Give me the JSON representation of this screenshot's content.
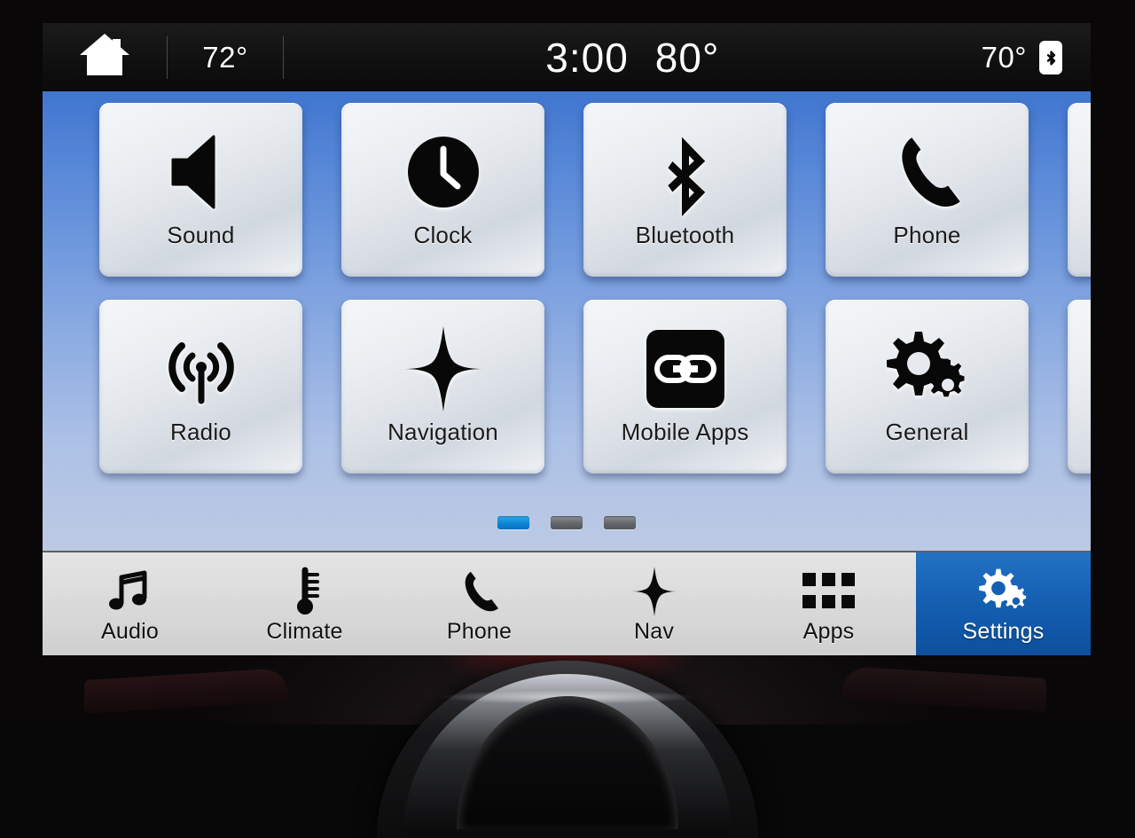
{
  "status_bar": {
    "home_icon": "home-icon",
    "left_temp": "72°",
    "clock": "3:00",
    "center_temp": "80°",
    "right_temp": "70°",
    "bluetooth_icon": "bluetooth-icon"
  },
  "settings_grid": {
    "tiles": [
      {
        "label": "Sound",
        "icon": "speaker-icon"
      },
      {
        "label": "Clock",
        "icon": "clock-icon"
      },
      {
        "label": "Bluetooth",
        "icon": "bluetooth-icon"
      },
      {
        "label": "Phone",
        "icon": "phone-handset-icon"
      },
      {
        "label": "",
        "icon": ""
      },
      {
        "label": "Radio",
        "icon": "radio-broadcast-icon"
      },
      {
        "label": "Navigation",
        "icon": "compass-star-icon"
      },
      {
        "label": "Mobile Apps",
        "icon": "chain-link-icon"
      },
      {
        "label": "General",
        "icon": "gears-icon"
      },
      {
        "label": "",
        "icon": ""
      }
    ],
    "pagination": {
      "total_pages": 3,
      "current_page": 1
    }
  },
  "nav_bar": {
    "items": [
      {
        "label": "Audio",
        "icon": "music-note-icon",
        "active": false
      },
      {
        "label": "Climate",
        "icon": "thermometer-icon",
        "active": false
      },
      {
        "label": "Phone",
        "icon": "phone-handset-icon",
        "active": false
      },
      {
        "label": "Nav",
        "icon": "compass-star-icon",
        "active": false
      },
      {
        "label": "Apps",
        "icon": "grid-apps-icon",
        "active": false
      },
      {
        "label": "Settings",
        "icon": "gears-icon",
        "active": true
      }
    ]
  },
  "colors": {
    "accent_blue": "#0d85d4",
    "active_tab_blue": "#1560b2",
    "screen_bg_top": "#4076cf",
    "screen_bg_bottom": "#bcc9e3",
    "status_bar_bg": "#111111",
    "nav_bar_bg": "#dcdcdc"
  }
}
